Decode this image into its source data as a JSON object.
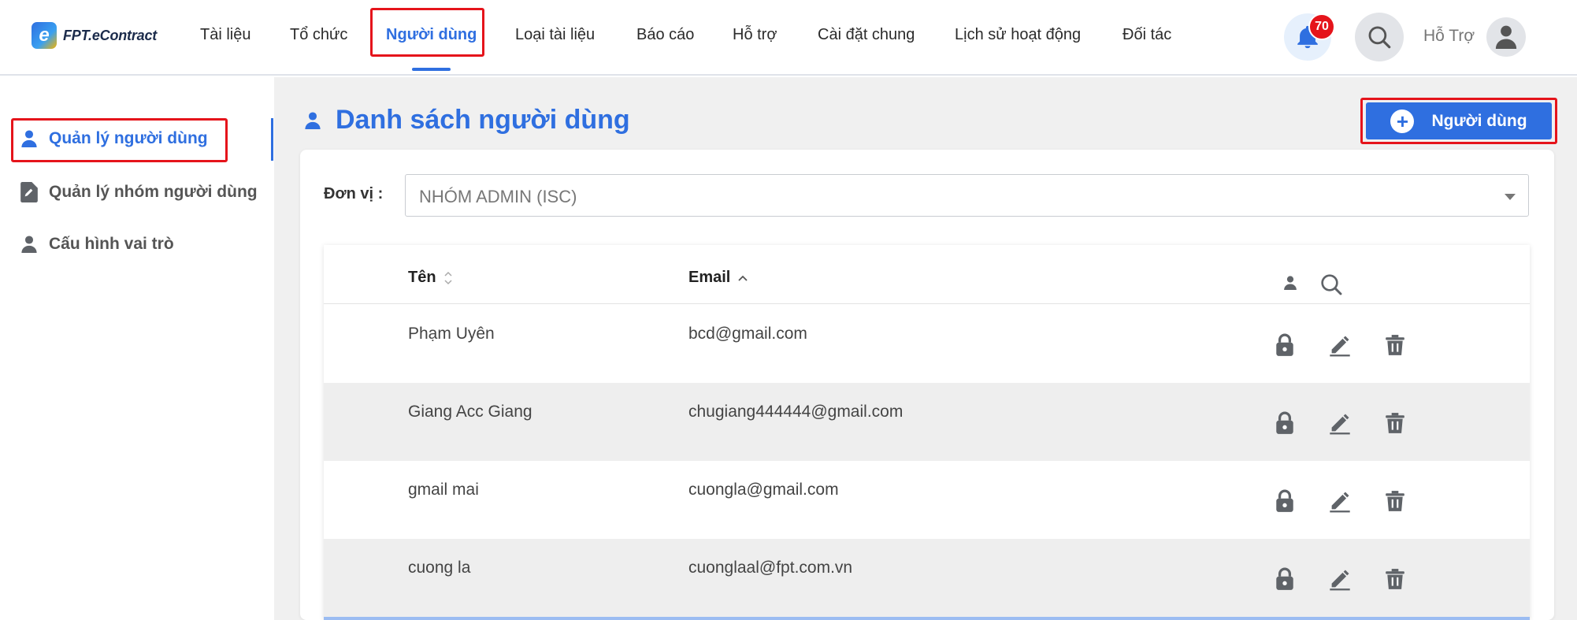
{
  "app": {
    "logo_text": "FPT.eContract",
    "logo_mark": "e"
  },
  "nav": {
    "items": [
      {
        "label": "Tài liệu"
      },
      {
        "label": "Tổ chức"
      },
      {
        "label": "Người dùng",
        "active": true
      },
      {
        "label": "Loại tài liệu"
      },
      {
        "label": "Báo cáo"
      },
      {
        "label": "Hỗ trợ"
      },
      {
        "label": "Cài đặt chung"
      },
      {
        "label": "Lịch sử hoạt động"
      },
      {
        "label": "Đối tác"
      }
    ],
    "notification_count": "70",
    "user_label": "Hỗ Trợ"
  },
  "sidebar": {
    "items": [
      {
        "label": "Quản lý người dùng",
        "icon": "user-icon",
        "active": true
      },
      {
        "label": "Quản lý nhóm người dùng",
        "icon": "document-edit-icon"
      },
      {
        "label": "Cấu hình vai trò",
        "icon": "user-icon"
      }
    ]
  },
  "page": {
    "title": "Danh sách người dùng",
    "add_button_label": "Người dùng",
    "unit_label": "Đơn vị :",
    "unit_value": "NHÓM ADMIN (ISC)"
  },
  "table": {
    "columns": {
      "name": "Tên",
      "email": "Email"
    },
    "rows": [
      {
        "name": "Phạm Uyên",
        "email": "bcd@gmail.com"
      },
      {
        "name": "Giang Acc Giang",
        "email": "chugiang444444@gmail.com"
      },
      {
        "name": "gmail mai",
        "email": "cuongla@gmail.com"
      },
      {
        "name": "cuong la",
        "email": "cuonglaal@fpt.com.vn"
      }
    ]
  },
  "colors": {
    "accent": "#2f6fe0",
    "highlight": "#e5141b",
    "badge": "#e5141b",
    "icon_gray": "#5f6368"
  }
}
